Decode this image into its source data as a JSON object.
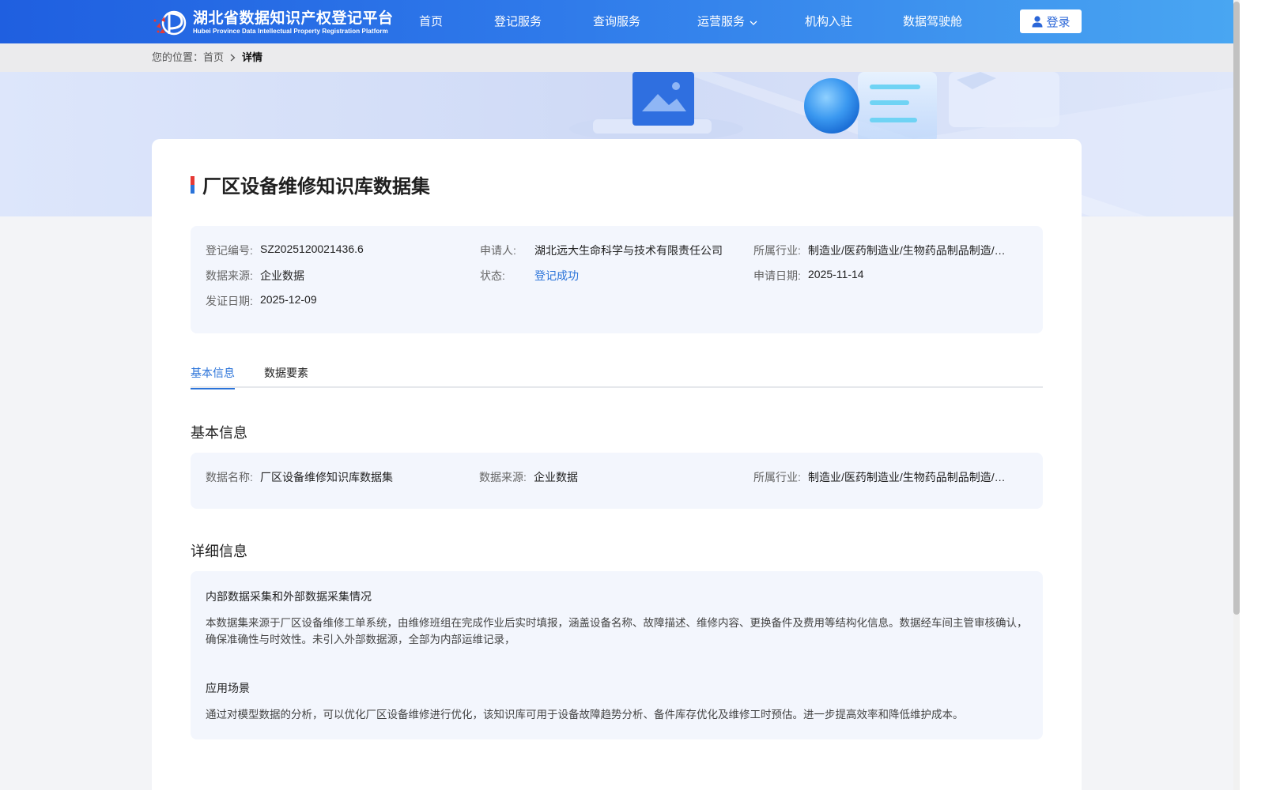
{
  "header": {
    "logo_cn": "湖北省数据知识产权登记平台",
    "logo_en": "Hubei Province Data Intellectual Property Registration Platform",
    "nav": [
      {
        "label": "首页"
      },
      {
        "label": "登记服务"
      },
      {
        "label": "查询服务"
      },
      {
        "label": "运营服务"
      },
      {
        "label": "机构入驻"
      },
      {
        "label": "数据驾驶舱"
      }
    ],
    "login_label": "登录"
  },
  "breadcrumb": {
    "prefix": "您的位置：",
    "home": "首页",
    "current": "详情"
  },
  "detail": {
    "title": "厂区设备维修知识库数据集",
    "summary": {
      "reg_no_label": "登记编号:",
      "reg_no": "SZ2025120021436.6",
      "applicant_label": "申请人:",
      "applicant": "湖北远大生命科学与技术有限责任公司",
      "industry_label": "所属行业:",
      "industry": "制造业/医药制造业/生物药品制品制造/生物药品制造",
      "source_label": "数据来源:",
      "source": "企业数据",
      "status_label": "状态:",
      "status": "登记成功",
      "apply_date_label": "申请日期:",
      "apply_date": "2025-11-14",
      "issue_date_label": "发证日期:",
      "issue_date": "2025-12-09"
    },
    "tabs": [
      {
        "label": "基本信息",
        "active": true
      },
      {
        "label": "数据要素",
        "active": false
      }
    ],
    "basic": {
      "heading": "基本信息",
      "name_label": "数据名称:",
      "name": "厂区设备维修知识库数据集",
      "source_label": "数据来源:",
      "source": "企业数据",
      "industry_label": "所属行业:",
      "industry": "制造业/医药制造业/生物药品制品制造/生物药品制造"
    },
    "more": {
      "heading": "详细信息",
      "collection_title": "内部数据采集和外部数据采集情况",
      "collection_text": "本数据集来源于厂区设备维修工单系统，由维修班组在完成作业后实时填报，涵盖设备名称、故障描述、维修内容、更换备件及费用等结构化信息。数据经车间主管审核确认，确保准确性与时效性。未引入外部数据源，全部为内部运维记录，",
      "scenario_title": "应用场景",
      "scenario_text": "通过对模型数据的分析，可以优化厂区设备维修进行优化，该知识库可用于设备故障趋势分析、备件库存优化及维修工时预估。进一步提高效率和降低维护成本。"
    }
  },
  "colors": {
    "nav_start": "#1f5fe0",
    "nav_end": "#49a6f2",
    "accent": "#2a73d9",
    "panel_bg": "#f3f6fd"
  }
}
